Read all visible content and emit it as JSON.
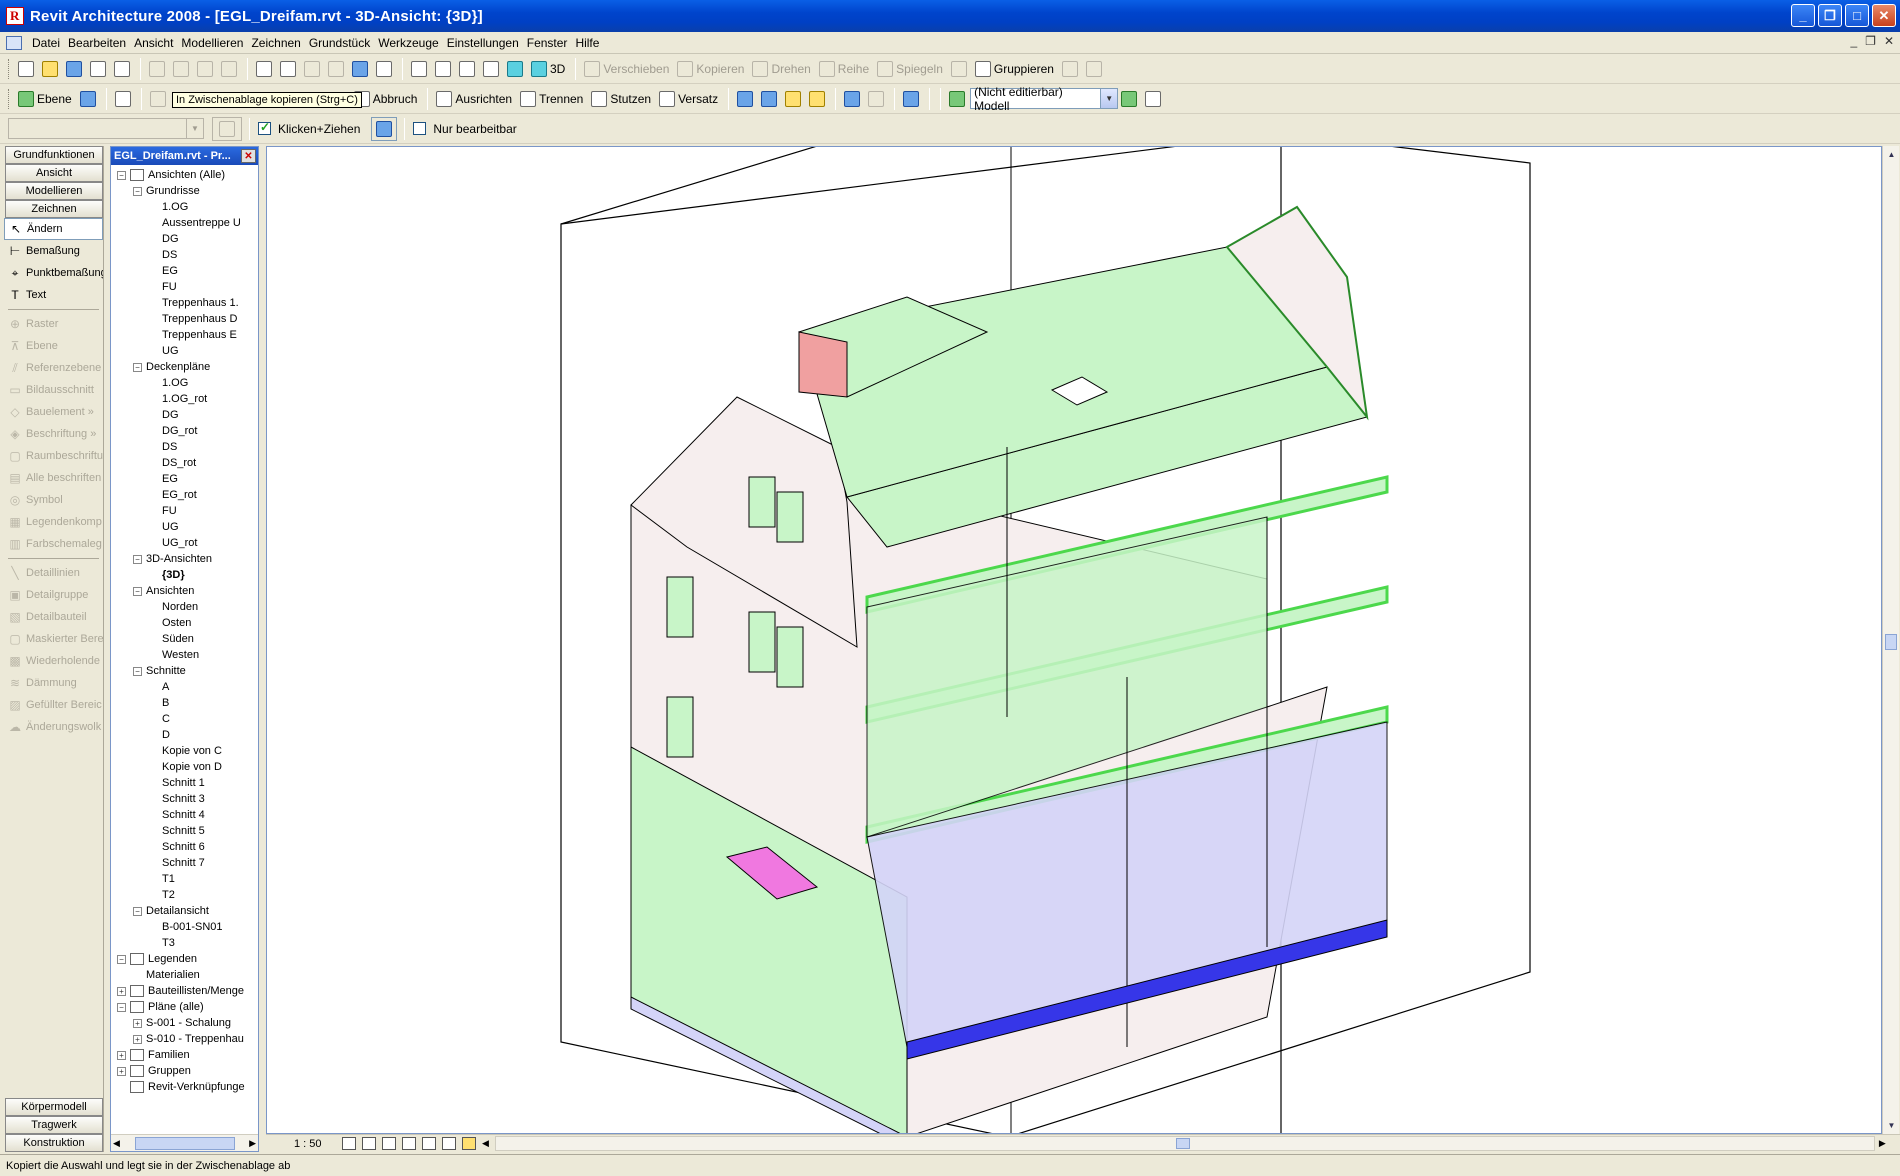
{
  "window": {
    "title": "Revit Architecture 2008 - [EGL_Dreifam.rvt - 3D-Ansicht: {3D}]",
    "controls": [
      "_",
      "❐",
      "□",
      "✕"
    ]
  },
  "menu": {
    "items": [
      "Datei",
      "Bearbeiten",
      "Ansicht",
      "Modellieren",
      "Zeichnen",
      "Grundstück",
      "Werkzeuge",
      "Einstellungen",
      "Fenster",
      "Hilfe"
    ],
    "mdi_controls": [
      "_",
      "❐",
      "✕"
    ]
  },
  "toolbar1": {
    "view3d_label": "3D",
    "edit_tools": [
      "Verschieben",
      "Kopieren",
      "Drehen",
      "Reihe",
      "Spiegeln"
    ],
    "group_label": "Gruppieren"
  },
  "toolbar2": {
    "level_label": "Ebene",
    "cancel_label": "Abbruch",
    "align_label": "Ausrichten",
    "split_label": "Trennen",
    "trim_label": "Stutzen",
    "offset_label": "Versatz",
    "workset_value": "(Nicht editierbar) Modell"
  },
  "tooltip": "In Zwischenablage kopieren (Strg+C)",
  "toolbar3": {
    "click_drag_label": "Klicken+Ziehen",
    "click_drag_checked": true,
    "editable_only_label": "Nur bearbeitbar",
    "editable_only_checked": false
  },
  "designbar": {
    "tabs_top": [
      "Grundfunktionen",
      "Ansicht",
      "Modellieren",
      "Zeichnen"
    ],
    "tools": [
      {
        "label": "Ändern",
        "icon": "cursor-arrow-icon",
        "enabled": true,
        "active": true
      },
      {
        "label": "Bemaßung",
        "icon": "dimension-icon",
        "enabled": true
      },
      {
        "label": "Punktbemaßung",
        "icon": "spot-dimension-icon",
        "enabled": true
      },
      {
        "label": "Text",
        "icon": "text-icon",
        "enabled": true
      },
      {
        "label": "Raster",
        "icon": "grid-icon",
        "enabled": false
      },
      {
        "label": "Ebene",
        "icon": "level-icon",
        "enabled": false
      },
      {
        "label": "Referenzebene",
        "icon": "reference-plane-icon",
        "enabled": false
      },
      {
        "label": "Bildausschnitt",
        "icon": "crop-icon",
        "enabled": false
      },
      {
        "label": "Bauelement »",
        "icon": "component-icon",
        "enabled": false
      },
      {
        "label": "Beschriftung »",
        "icon": "tag-icon",
        "enabled": false
      },
      {
        "label": "Raumbeschriftu",
        "icon": "room-tag-icon",
        "enabled": false
      },
      {
        "label": "Alle beschriften",
        "icon": "tag-all-icon",
        "enabled": false
      },
      {
        "label": "Symbol",
        "icon": "symbol-icon",
        "enabled": false
      },
      {
        "label": "Legendenkomp",
        "icon": "legend-icon",
        "enabled": false
      },
      {
        "label": "Farbschemaleg",
        "icon": "color-scheme-icon",
        "enabled": false
      },
      {
        "label": "Detaillinien",
        "icon": "detail-line-icon",
        "enabled": false
      },
      {
        "label": "Detailgruppe",
        "icon": "detail-group-icon",
        "enabled": false
      },
      {
        "label": "Detailbauteil",
        "icon": "detail-component-icon",
        "enabled": false
      },
      {
        "label": "Maskierter Bere",
        "icon": "masking-region-icon",
        "enabled": false
      },
      {
        "label": "Wiederholende",
        "icon": "repeating-detail-icon",
        "enabled": false
      },
      {
        "label": "Dämmung",
        "icon": "insulation-icon",
        "enabled": false
      },
      {
        "label": "Gefüllter Bereic",
        "icon": "filled-region-icon",
        "enabled": false
      },
      {
        "label": "Änderungswolk",
        "icon": "revision-cloud-icon",
        "enabled": false
      }
    ],
    "tabs_bottom": [
      "Körpermodell",
      "Tragwerk",
      "Konstruktion"
    ]
  },
  "browser": {
    "title": "EGL_Dreifam.rvt - Pr...",
    "nodes": [
      {
        "label": "Ansichten (Alle)",
        "level": 0,
        "toggle": "-",
        "icon": true
      },
      {
        "label": "Grundrisse",
        "level": 1,
        "toggle": "-"
      },
      {
        "label": "1.OG",
        "level": 2
      },
      {
        "label": "Aussentreppe U",
        "level": 2
      },
      {
        "label": "DG",
        "level": 2
      },
      {
        "label": "DS",
        "level": 2
      },
      {
        "label": "EG",
        "level": 2
      },
      {
        "label": "FU",
        "level": 2
      },
      {
        "label": "Treppenhaus 1.",
        "level": 2
      },
      {
        "label": "Treppenhaus D",
        "level": 2
      },
      {
        "label": "Treppenhaus E",
        "level": 2
      },
      {
        "label": "UG",
        "level": 2
      },
      {
        "label": "Deckenpläne",
        "level": 1,
        "toggle": "-"
      },
      {
        "label": "1.OG",
        "level": 2
      },
      {
        "label": "1.OG_rot",
        "level": 2
      },
      {
        "label": "DG",
        "level": 2
      },
      {
        "label": "DG_rot",
        "level": 2
      },
      {
        "label": "DS",
        "level": 2
      },
      {
        "label": "DS_rot",
        "level": 2
      },
      {
        "label": "EG",
        "level": 2
      },
      {
        "label": "EG_rot",
        "level": 2
      },
      {
        "label": "FU",
        "level": 2
      },
      {
        "label": "UG",
        "level": 2
      },
      {
        "label": "UG_rot",
        "level": 2
      },
      {
        "label": "3D-Ansichten",
        "level": 1,
        "toggle": "-"
      },
      {
        "label": "{3D}",
        "level": 2,
        "bold": true
      },
      {
        "label": "Ansichten",
        "level": 1,
        "toggle": "-"
      },
      {
        "label": "Norden",
        "level": 2
      },
      {
        "label": "Osten",
        "level": 2
      },
      {
        "label": "Süden",
        "level": 2
      },
      {
        "label": "Westen",
        "level": 2
      },
      {
        "label": "Schnitte",
        "level": 1,
        "toggle": "-"
      },
      {
        "label": "A",
        "level": 2
      },
      {
        "label": "B",
        "level": 2
      },
      {
        "label": "C",
        "level": 2
      },
      {
        "label": "D",
        "level": 2
      },
      {
        "label": "Kopie von C",
        "level": 2
      },
      {
        "label": "Kopie von D",
        "level": 2
      },
      {
        "label": "Schnitt 1",
        "level": 2
      },
      {
        "label": "Schnitt 3",
        "level": 2
      },
      {
        "label": "Schnitt 4",
        "level": 2
      },
      {
        "label": "Schnitt 5",
        "level": 2
      },
      {
        "label": "Schnitt 6",
        "level": 2
      },
      {
        "label": "Schnitt 7",
        "level": 2
      },
      {
        "label": "T1",
        "level": 2
      },
      {
        "label": "T2",
        "level": 2
      },
      {
        "label": "Detailansicht",
        "level": 1,
        "toggle": "-"
      },
      {
        "label": "B-001-SN01",
        "level": 2
      },
      {
        "label": "T3",
        "level": 2
      },
      {
        "label": "Legenden",
        "level": 0,
        "toggle": "-",
        "icon": true
      },
      {
        "label": "Materialien",
        "level": 1
      },
      {
        "label": "Bauteillisten/Menge",
        "level": 0,
        "toggle": "+",
        "icon": true
      },
      {
        "label": "Pläne (alle)",
        "level": 0,
        "toggle": "-",
        "icon": true
      },
      {
        "label": "S-001 - Schalung",
        "level": 1,
        "toggle": "+"
      },
      {
        "label": "S-010 - Treppenhau",
        "level": 1,
        "toggle": "+"
      },
      {
        "label": "Familien",
        "level": 0,
        "toggle": "+",
        "icon": true
      },
      {
        "label": "Gruppen",
        "level": 0,
        "toggle": "+",
        "icon": true
      },
      {
        "label": "Revit-Verknüpfunge",
        "level": 0,
        "icon": true
      }
    ]
  },
  "viewbar": {
    "scale": "1 : 50"
  },
  "status": {
    "text": "Kopiert die Auswahl und legt sie in der Zwischenablage ab"
  },
  "colors": {
    "wall_section": "#c8f5c8",
    "wall_edge": "#6ee86e",
    "exterior_wall": "#f6eeee",
    "floor_fill": "#d4d4f8",
    "slab_edge": "#3636e8",
    "stair": "#f078e0",
    "chimney_cut": "#f0a0a0"
  }
}
